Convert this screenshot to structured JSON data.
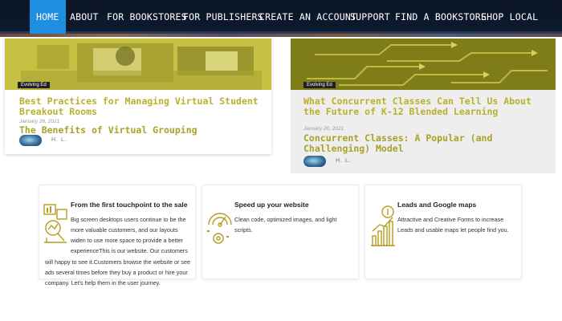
{
  "nav": {
    "items": [
      "HOME",
      "ABOUT",
      "FOR BOOKSTORES",
      "FOR PUBLISHERS",
      "CREATE AN ACCOUNT",
      "SUPPORT",
      "FIND A BOOKSTORE",
      "SHOP LOCAL"
    ],
    "active_color": "#1e8fe0",
    "background": "#0d1a2e"
  },
  "posts": [
    {
      "badge": "Evolving Ed",
      "title": "Best Practices for Managing Virtual Student Breakout Rooms",
      "date": "January 26, 2021",
      "related_title": "The Benefits of Virtual Grouping",
      "author": "H. L.",
      "image_tint": "#d4d04a"
    },
    {
      "badge": "Evolving Ed",
      "title": "What Concurrent Classes Can Tell Us About the Future of K-12 Blended Learning",
      "date": "January 20, 2021",
      "related_title": "Concurrent Classes: A Popular (and Challenging) Model",
      "author": "H. L.",
      "image_tint": "#8a8a1a"
    }
  ],
  "features": [
    {
      "icon": "touchpoint-analytics-icon",
      "title": "From the first touchpoint to the sale",
      "text": "Big screen desktops users continue to be the more valuable customers, and our layouts widen to use more space to provide a better experienceThis is our website. Our customers will happy to see it.Customers browse the website or see ads several times before they buy a product or hire your company. Let's help them in the user journey."
    },
    {
      "icon": "speedometer-icon",
      "title": "Speed up your website",
      "text": "Clean code, optimized images, and light scripts."
    },
    {
      "icon": "growth-chart-icon",
      "title": "Leads and Google maps",
      "text": "Attractive and Creative Forms to increase Leads and usable maps let people find you."
    }
  ],
  "colors": {
    "accent_gold": "#b9b02c",
    "icon_gold": "#c9a227"
  }
}
